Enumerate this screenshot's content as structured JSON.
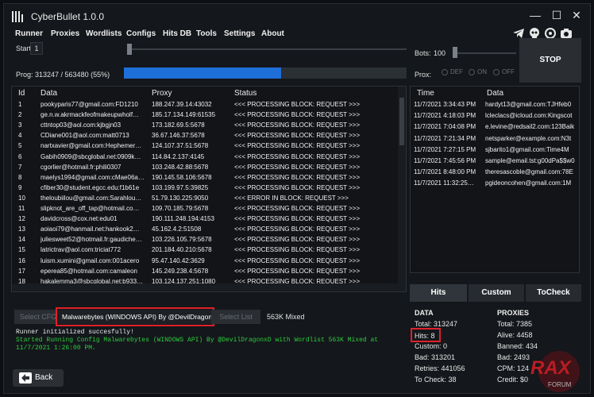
{
  "app": {
    "title": "CyberBullet 1.0.0"
  },
  "menu": [
    "Runner",
    "Proxies",
    "Wordlists",
    "Configs",
    "Hits DB",
    "Tools",
    "Settings",
    "About"
  ],
  "controls": {
    "start_label": "Start:",
    "start_value": "1",
    "bots_label": "Bots:",
    "bots_value": "100",
    "stop_label": "STOP",
    "prog_label": "Prog: 313247 / 563480 (55%)",
    "progress_fraction": 0.556,
    "prox_label": "Prox:",
    "prox_options": [
      "DEF",
      "ON",
      "OFF"
    ]
  },
  "table": {
    "headers": [
      "Id",
      "Data",
      "Proxy",
      "Status"
    ],
    "rows": [
      [
        "1",
        "pookyparis77@gmail.com:FD1210",
        "188.247.39.14:43032",
        "<<< PROCESSING BLOCK: REQUEST >>>"
      ],
      [
        "2",
        "ge.n.w.akrmackfeofmakeupwholf…",
        "185.17.134.149:61535",
        "<<< PROCESSING BLOCK: REQUEST >>>"
      ],
      [
        "3",
        "cttntop03@aol.com:kjbgjn03",
        "173.182.69.5:5678",
        "<<< PROCESSING BLOCK: REQUEST >>>"
      ],
      [
        "4",
        "CDiane001@aol.com:matt0713",
        "36.67.146.37:5678",
        "<<< PROCESSING BLOCK: REQUEST >>>"
      ],
      [
        "5",
        "nartxavier@gmail.com:Hephemer…",
        "124.107.37.51:5678",
        "<<< PROCESSING BLOCK: REQUEST >>>"
      ],
      [
        "6",
        "Gabih0909@sbcglobal.net:0909k…",
        "114.84.2.137:4145",
        "<<< PROCESSING BLOCK: REQUEST >>>"
      ],
      [
        "7",
        "cgorlier@hotmail.fr:phili0307",
        "103.248.42.88:5678",
        "<<< PROCESSING BLOCK: REQUEST >>>"
      ],
      [
        "8",
        "maelys1994@gmail.com:cMae06a…",
        "190.145.58.106:5678",
        "<<< PROCESSING BLOCK: REQUEST >>>"
      ],
      [
        "9",
        "cfiber30@student.egcc.edu:f1b61e",
        "103.199.97.5:39825",
        "<<< PROCESSING BLOCK: REQUEST >>>"
      ],
      [
        "10",
        "theloubiilou@gmail.com:Sarahlou…",
        "51.79.130.225:9050",
        "<<< ERROR IN BLOCK: REQUEST >>>"
      ],
      [
        "11",
        "slipknot_are_off_tap@hotmail.co…",
        "109.70.185.79:5678",
        "<<< PROCESSING BLOCK: REQUEST >>>"
      ],
      [
        "12",
        "davidcross@cox.net:edu01",
        "190.111.248.194:4153",
        "<<< PROCESSING BLOCK: REQUEST >>>"
      ],
      [
        "13",
        "aoiaoi79@hanmail.net:hankook2…",
        "45.162.4.2:51508",
        "<<< PROCESSING BLOCK: REQUEST >>>"
      ],
      [
        "14",
        "juliesweet52@hotmail.fr:gaudiche…",
        "103.226.105.79:5678",
        "<<< PROCESSING BLOCK: REQUEST >>>"
      ],
      [
        "15",
        "latrictrav@aol.com:triciat772",
        "201.184.40.210:5678",
        "<<< PROCESSING BLOCK: REQUEST >>>"
      ],
      [
        "16",
        "luism.xumini@gmail.com:001acero",
        "95.47.140.42:3629",
        "<<< PROCESSING BLOCK: REQUEST >>>"
      ],
      [
        "17",
        "eperea85@hotmail.com:camaleon",
        "145.249.238.4:5678",
        "<<< PROCESSING BLOCK: REQUEST >>>"
      ],
      [
        "18",
        "hakalemma3@sbcglobal.net:b933…",
        "103.124.137.251:1080",
        "<<< PROCESSING BLOCK: REQUEST >>>"
      ]
    ]
  },
  "hits_table": {
    "headers": [
      "Time",
      "Data"
    ],
    "rows": [
      [
        "11/7/2021 3:34:43 PM",
        "hardyt13@gmail.com:TJHfeb0"
      ],
      [
        "11/7/2021 4:18:03 PM",
        "lcleclacs@icloud.com:Kingscot"
      ],
      [
        "11/7/2021 7:04:08 PM",
        "e.levine@redsail2.com:123Baik"
      ],
      [
        "11/7/2021 7:21:34 PM",
        "netsparker@example.com:N3t"
      ],
      [
        "11/7/2021 7:27:15 PM",
        "sjbarito1@gmail.com:Time4M"
      ],
      [
        "11/7/2021 7:45:56 PM",
        "sample@email.tst:g00dPa$$w0"
      ],
      [
        "11/7/2021 8:48:00 PM",
        "theresascoble@gmail.com:78E"
      ],
      [
        "11/7/2021 11:32:25…",
        "pgideoncohen@gmail.com:1M"
      ]
    ]
  },
  "hits_tabs": [
    "Hits",
    "Custom",
    "ToCheck"
  ],
  "config": {
    "select_cfg": "Select CFG",
    "config_name": "Malwarebytes (WINDOWS API) By @DevilDragonxD",
    "select_list": "Select List",
    "wordlist_name": "563K Mixed"
  },
  "log": {
    "line1": "Runner initialized succesfully!",
    "line2": "Started Running Config Malwarebytes (WINDOWS API) By @DevilDragonxD with Wordlist 563K Mixed at",
    "line3": "11/7/2021 1:26:00 PM."
  },
  "back_label": "Back",
  "data_stats": {
    "heading": "DATA",
    "total": "Total:   313247",
    "hits": "Hits:  8",
    "custom": "Custom:  0",
    "bad": "Bad:   313201",
    "retries": "Retries:  441056",
    "tocheck": "To Check:  38"
  },
  "proxy_stats": {
    "heading": "PROXIES",
    "total": "Total:   7385",
    "alive": "Alive:    4458",
    "banned": "Banned:   434",
    "bad": "Bad:   2493",
    "cpm": "CPM:   124",
    "credit": "Credit:   $0"
  },
  "watermark": {
    "text": "RAX",
    "sub": "FORUM"
  },
  "colors": {
    "accent": "#1e6fd9",
    "highlight": "#e0202a",
    "log_green": "#2ecc40"
  }
}
